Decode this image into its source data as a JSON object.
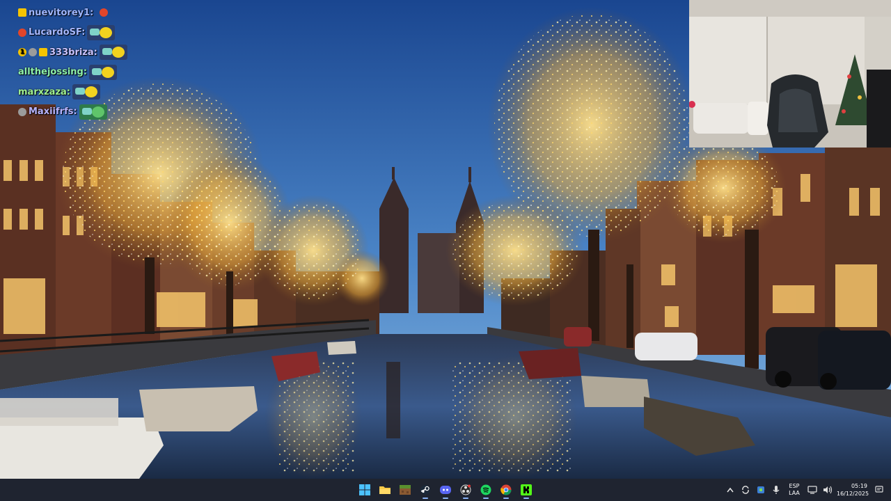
{
  "chat": {
    "messages": [
      {
        "username": "nuevitorey1",
        "color": "#9fb6ff",
        "badges": [
          "yellow"
        ],
        "emote": "small"
      },
      {
        "username": "LucardoSF",
        "color": "#a7b8ff",
        "badges": [
          "red-circle"
        ],
        "emote": "minion"
      },
      {
        "username": "333briza",
        "color": "#c9c3ff",
        "badges": [
          "count-1",
          "gray-circle",
          "yellow"
        ],
        "emote": "minion"
      },
      {
        "username": "allthejossing",
        "color": "#8ef0a8",
        "badges": [],
        "emote": "minion"
      },
      {
        "username": "marxzaza",
        "color": "#a0f090",
        "badges": [],
        "emote": "minion"
      },
      {
        "username": "Maxiifrfs",
        "color": "#b7b4ff",
        "badges": [
          "gray-circle"
        ],
        "emote": "minion-green"
      }
    ],
    "separator": ":",
    "badge_count_text": "1"
  },
  "taskbar": {
    "apps": [
      {
        "name": "start",
        "icon": "windows-icon"
      },
      {
        "name": "file-explorer",
        "icon": "folder-icon"
      },
      {
        "name": "minecraft",
        "icon": "minecraft-icon"
      },
      {
        "name": "steam",
        "icon": "steam-icon"
      },
      {
        "name": "discord",
        "icon": "discord-icon"
      },
      {
        "name": "obs",
        "icon": "obs-icon"
      },
      {
        "name": "spotify",
        "icon": "spotify-icon"
      },
      {
        "name": "chrome",
        "icon": "chrome-icon"
      },
      {
        "name": "kick",
        "icon": "kick-icon"
      }
    ],
    "tray": {
      "language_top": "ESP",
      "language_bottom": "LAA",
      "time": "05:19",
      "date": "16/12/2025"
    }
  },
  "colors": {
    "taskbar_bg": "#1f2430",
    "sky_top": "#1b4a93",
    "sky_bottom": "#7fb3e0",
    "lights": "#ffd36a",
    "kick_green": "#53fc18",
    "spotify_green": "#1ed760"
  }
}
